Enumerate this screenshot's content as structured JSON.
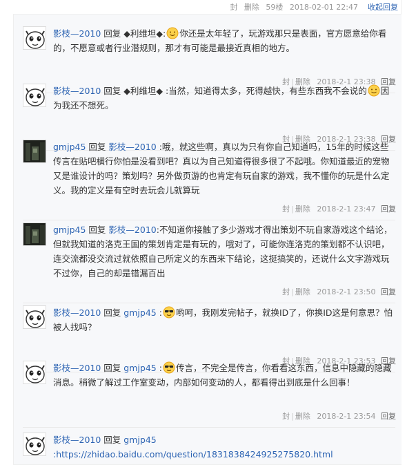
{
  "top": {
    "seal": "封",
    "delete": "删除",
    "floor": "59楼",
    "time": "2018-02-01 22:47",
    "collapse": "收起回复"
  },
  "icons": {
    "avatar_a": "cartoon-face-avatar-icon",
    "avatar_b": "dark-photo-avatar-icon",
    "emoticon_smile": "smile-emoticon-icon",
    "emoticon_cool": "sunglasses-emoticon-icon"
  },
  "replies": [
    {
      "user": "影枝—2010",
      "prefix": "回复",
      "target": "◆利维坦◆",
      "colon": ":",
      "text": "你还是太年轻了，玩游戏那只是表面，官方愿意给你看的，不愿意或者行业潜规则，那才有可能是最接近真相的地方。",
      "seal": "封",
      "delete": "删除",
      "time": "2018-2-1 23:38",
      "reply": "回复"
    },
    {
      "user": "影枝—2010",
      "prefix": "回复",
      "target": "◆利维坦◆",
      "text_a": ":当然，知道得太多，死得越快，有些东西我不会说的",
      "text_b": "因为我还不想死。",
      "seal": "封",
      "delete": "删除",
      "time": "2018-2-1 23:38",
      "reply": "回复"
    },
    {
      "user": "gmjp45",
      "prefix": "回复",
      "target": "影枝—2010",
      "text": ":哦，就这些啊，真以为只有你自己知道吗，15年的时候这些传言在贴吧横行你怕是没看到吧？真以为自己知道得很多很了不起哦。你知道最近的宠物又是谁设计的吗？策划吗？另外做页游的也肯定有玩自家的游戏，我不懂你的玩是什么定义。我的定义是有空时去玩会儿就算玩",
      "seal": "封",
      "delete": "删除",
      "time": "2018-2-1 23:47",
      "reply": "回复"
    },
    {
      "user": "gmjp45",
      "prefix": "回复",
      "target": "影枝—2010",
      "text": ":不知道你接触了多少游戏才得出策划不玩自家游戏这个结论，但就我知道的洛克王国的策划肯定是有玩的，哦对了，可能你连洛克的策划都不认识吧，连交流都没交流过就依照自己所定义的东西来下结论，这挺搞笑的，还说什么文字游戏玩不过你，自己的却是错漏百出",
      "seal": "封",
      "delete": "删除",
      "time": "2018-2-1 23:50",
      "reply": "回复"
    },
    {
      "user": "影枝—2010",
      "prefix": "回复",
      "target": "gmjp45",
      "colon": ":",
      "text": "哟呵，我刚发完帖子，就换ID了，你换ID这是何意思？怕被人找吗？",
      "seal": "封",
      "delete": "删除",
      "time": "2018-2-1 23:53",
      "reply": "回复"
    },
    {
      "user": "影枝—2010",
      "prefix": "回复",
      "target": "gmjp45",
      "colon": ":",
      "text": "传言，不完全是传言，你看看这东西，信息中隐藏的隐藏消息。稍微了解过工作室变动，内部如何变动的人，都看得出到底是什么回事！",
      "seal": "封",
      "delete": "删除",
      "time": "2018-2-1 23:54",
      "reply": "回复"
    },
    {
      "user": "影枝—2010",
      "prefix": "回复",
      "target": "gmjp45",
      "link": ":https://zhidao.baidu.com/question/1831838424925275820.html"
    }
  ]
}
